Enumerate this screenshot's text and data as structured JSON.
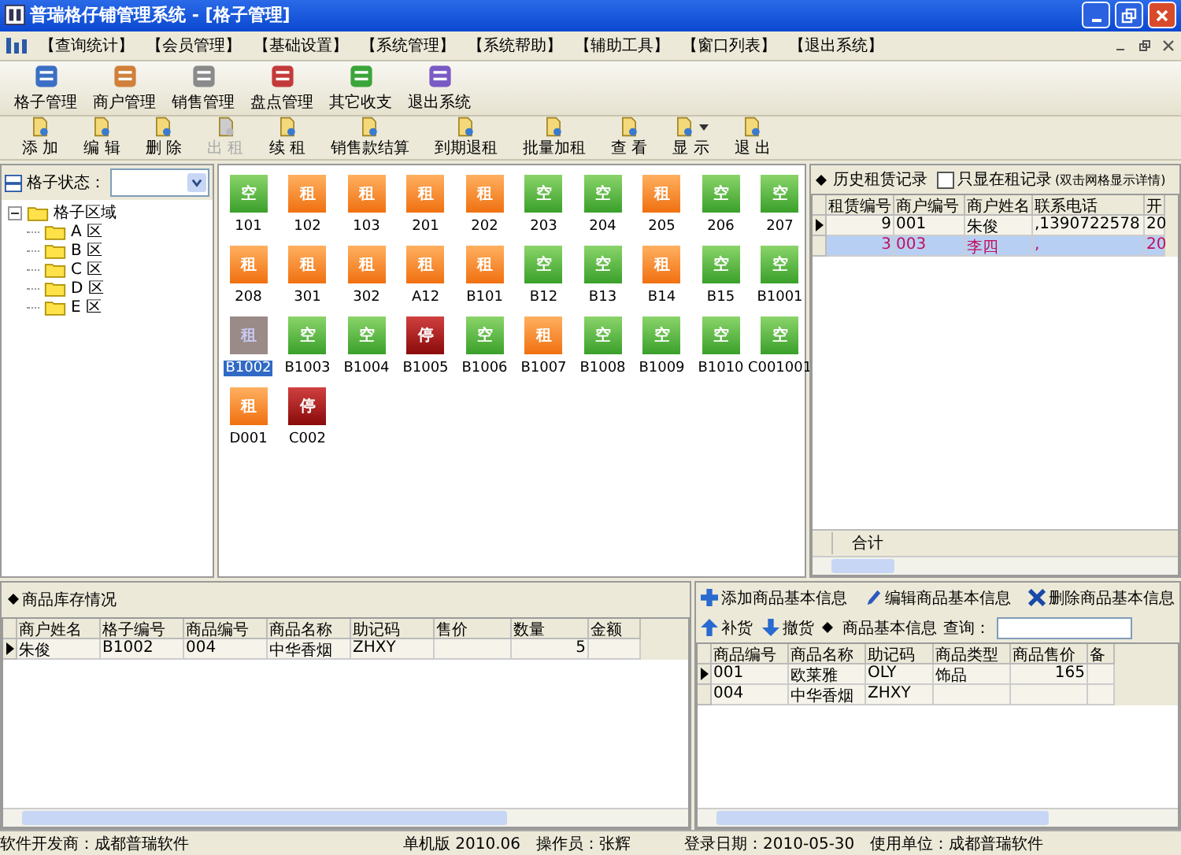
{
  "window": {
    "title": "普瑞格仔铺管理系统 - [格子管理]"
  },
  "menu": [
    "【查询统计】",
    "【会员管理】",
    "【基础设置】",
    "【系统管理】",
    "【系统帮助】",
    "【辅助工具】",
    "【窗口列表】",
    "【退出系统】"
  ],
  "main_toolbar": [
    {
      "label": "格子管理"
    },
    {
      "label": "商户管理"
    },
    {
      "label": "销售管理"
    },
    {
      "label": "盘点管理"
    },
    {
      "label": "其它收支"
    },
    {
      "label": "退出系统"
    }
  ],
  "action_toolbar": [
    {
      "label": "添 加",
      "disabled": false
    },
    {
      "label": "编 辑",
      "disabled": false
    },
    {
      "label": "删 除",
      "disabled": false
    },
    {
      "label": "出 租",
      "disabled": true
    },
    {
      "label": "续 租",
      "disabled": false
    },
    {
      "label": "销售款结算",
      "disabled": false
    },
    {
      "label": "到期退租",
      "disabled": false
    },
    {
      "label": "批量加租",
      "disabled": false
    },
    {
      "label": "查 看",
      "disabled": false
    },
    {
      "label": "显 示",
      "disabled": false,
      "dropdown": true
    },
    {
      "label": "退 出",
      "disabled": false
    }
  ],
  "filter": {
    "label": "格子状态："
  },
  "tree": {
    "label": "格子区域",
    "expanded": true,
    "children": [
      {
        "label": "A 区"
      },
      {
        "label": "B 区"
      },
      {
        "label": "C 区"
      },
      {
        "label": "D 区"
      },
      {
        "label": "E 区"
      }
    ]
  },
  "stalls": [
    {
      "code": "101",
      "status": "空",
      "kind": "empty",
      "selected": false
    },
    {
      "code": "102",
      "status": "租",
      "kind": "rented",
      "selected": false
    },
    {
      "code": "103",
      "status": "租",
      "kind": "rented",
      "selected": false
    },
    {
      "code": "201",
      "status": "租",
      "kind": "rented",
      "selected": false
    },
    {
      "code": "202",
      "status": "租",
      "kind": "rented",
      "selected": false
    },
    {
      "code": "203",
      "status": "空",
      "kind": "empty",
      "selected": false
    },
    {
      "code": "204",
      "status": "空",
      "kind": "empty",
      "selected": false
    },
    {
      "code": "205",
      "status": "租",
      "kind": "rented",
      "selected": false
    },
    {
      "code": "206",
      "status": "空",
      "kind": "empty",
      "selected": false
    },
    {
      "code": "207",
      "status": "空",
      "kind": "empty",
      "selected": false
    },
    {
      "code": "208",
      "status": "租",
      "kind": "rented",
      "selected": false
    },
    {
      "code": "301",
      "status": "租",
      "kind": "rented",
      "selected": false
    },
    {
      "code": "302",
      "status": "租",
      "kind": "rented",
      "selected": false
    },
    {
      "code": "A12",
      "status": "租",
      "kind": "rented",
      "selected": false
    },
    {
      "code": "B101",
      "status": "租",
      "kind": "rented",
      "selected": false
    },
    {
      "code": "B12",
      "status": "空",
      "kind": "empty",
      "selected": false
    },
    {
      "code": "B13",
      "status": "空",
      "kind": "empty",
      "selected": false
    },
    {
      "code": "B14",
      "status": "租",
      "kind": "rented",
      "selected": false
    },
    {
      "code": "B15",
      "status": "空",
      "kind": "empty",
      "selected": false
    },
    {
      "code": "B1001",
      "status": "空",
      "kind": "empty",
      "selected": false
    },
    {
      "code": "B1002",
      "status": "租",
      "kind": "rented",
      "selected": true
    },
    {
      "code": "B1003",
      "status": "空",
      "kind": "empty",
      "selected": false
    },
    {
      "code": "B1004",
      "status": "空",
      "kind": "empty",
      "selected": false
    },
    {
      "code": "B1005",
      "status": "停",
      "kind": "stopped",
      "selected": false
    },
    {
      "code": "B1006",
      "status": "空",
      "kind": "empty",
      "selected": false
    },
    {
      "code": "B1007",
      "status": "租",
      "kind": "rented",
      "selected": false
    },
    {
      "code": "B1008",
      "status": "空",
      "kind": "empty",
      "selected": false
    },
    {
      "code": "B1009",
      "status": "空",
      "kind": "empty",
      "selected": false
    },
    {
      "code": "B1010",
      "status": "空",
      "kind": "empty",
      "selected": false
    },
    {
      "code": "C001001",
      "status": "空",
      "kind": "empty",
      "selected": false
    },
    {
      "code": "D001",
      "status": "租",
      "kind": "rented",
      "selected": false
    },
    {
      "code": "C002",
      "status": "停",
      "kind": "stopped",
      "selected": false
    }
  ],
  "history": {
    "title": "历史租赁记录",
    "only_active": {
      "label": "只显在租记录",
      "checked": false
    },
    "hint": "(双击网格显示详情)",
    "columns": [
      "租赁编号",
      "商户编号",
      "商户姓名",
      "联系电话",
      "开"
    ],
    "rows": [
      {
        "cells": [
          "9",
          "001",
          "朱俊",
          ",1390722578",
          "20"
        ],
        "selected": false
      },
      {
        "cells": [
          "3",
          "003",
          "李四",
          ",",
          "20"
        ],
        "selected": true
      }
    ],
    "footer": "合计"
  },
  "inventory": {
    "title": "商品库存情况",
    "columns": [
      "商户姓名",
      "格子编号",
      "商品编号",
      "商品名称",
      "助记码",
      "售价",
      "数量",
      "金额"
    ],
    "rows": [
      {
        "cells": [
          "朱俊",
          "B1002",
          "004",
          "中华香烟",
          "ZHXY",
          "",
          "5",
          ""
        ]
      }
    ]
  },
  "products": {
    "actions": [
      "添加商品基本信息",
      "编辑商品基本信息",
      "删除商品基本信息"
    ],
    "stock_buttons": [
      "补货",
      "撤货"
    ],
    "title": "商品基本信息",
    "search_label": "查询：",
    "columns": [
      "商品编号",
      "商品名称",
      "助记码",
      "商品类型",
      "商品售价",
      "备"
    ],
    "rows": [
      {
        "cells": [
          "001",
          "欧莱雅",
          "OLY",
          "饰品",
          "165",
          ""
        ]
      },
      {
        "cells": [
          "004",
          "中华香烟",
          "ZHXY",
          "",
          "",
          ""
        ]
      }
    ]
  },
  "status_bar": [
    "软件开发商：成都普瑞软件",
    "单机版 2010.06",
    "操作员：张辉",
    "登录日期：2010-05-30",
    "使用单位：成都普瑞软件"
  ]
}
